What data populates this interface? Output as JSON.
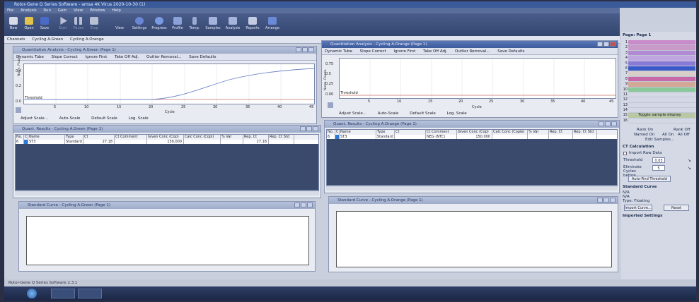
{
  "title": "Rotor-Gene Q Series Software - amsa 4K Virus 2020-10-30 (1)",
  "menu": [
    "File",
    "Analysis",
    "Run",
    "Gain",
    "View",
    "Window",
    "Help"
  ],
  "toolbar": {
    "new": "New",
    "open": "Open",
    "save": "Save",
    "start": "Start",
    "pause": "Pause",
    "stop": "Stop",
    "view": "View",
    "settings": "Settings",
    "progress": "Progress",
    "profile": "Profile",
    "temp": "Temp.",
    "samples": "Samples",
    "analysis": "Analysis",
    "reports": "Reports",
    "arrange": "Arrange"
  },
  "channels": {
    "label": "Channels",
    "green": "Cycling A.Green",
    "orange": "Cycling A.Orange"
  },
  "qa_green": {
    "title": "Quantitation Analysis - Cycling A.Green (Page 1)",
    "tools": [
      "Dynamic Tube",
      "Slope Correct",
      "Ignore First",
      "Take Off Adj.",
      "Outlier Removal...",
      "Save Defaults"
    ],
    "ylabel": "Norm. Fluoro.",
    "yticks": [
      "0.4",
      "0.2",
      "0.0"
    ],
    "xticks": [
      "5",
      "10",
      "15",
      "20",
      "25",
      "30",
      "35",
      "40",
      "45"
    ],
    "xlabel": "Cycle",
    "threshold": "Threshold",
    "scale": [
      "Adjust Scale...",
      "Auto-Scale",
      "Default Scale",
      "Log. Scale"
    ]
  },
  "qa_orange": {
    "title": "Quantitation Analysis - Cycling A.Orange (Page 1)",
    "tools": [
      "Dynamic Tube",
      "Slope Correct",
      "Ignore First",
      "Take Off Adj.",
      "Outlier Removal...",
      "Save Defaults"
    ],
    "ylabel": "Norm. Fluoro.",
    "yticks": [
      "0.75",
      "0.5",
      "0.25",
      "0.00"
    ],
    "xticks": [
      "5",
      "10",
      "15",
      "20",
      "25",
      "30",
      "35",
      "40",
      "45"
    ],
    "xlabel": "Cycle",
    "threshold": "Threshold",
    "scale": [
      "Adjust Scale...",
      "Auto-Scale",
      "Default Scale",
      "Log. Scale"
    ]
  },
  "qr_green": {
    "title": "Quant. Results - Cycling A.Green (Page 1)",
    "headers": [
      "No.",
      "C",
      "Name",
      "Type",
      "Ct",
      "Ct Comment",
      "Given Conc (Cop)",
      "Calc Conc (Copi)",
      "% Var",
      "Rep. Ct",
      "Rep. Ct Std"
    ],
    "row": [
      "6",
      "",
      "ST3",
      "Standard",
      "27.18",
      "",
      "150,000",
      "",
      "",
      "27.18",
      ""
    ]
  },
  "qr_orange": {
    "title": "Quant. Results - Cycling A.Orange (Page 1)",
    "headers": [
      "No.",
      "C",
      "Name",
      "Type",
      "Ct",
      "Ct Comment",
      "Given Conc (Cop)",
      "Calc Conc (Copie)",
      "% Var",
      "Rep. Ct",
      "Rep. Ct Std"
    ],
    "row": [
      "6",
      "",
      "ST3",
      "Standard",
      "",
      "NEG (NTC)",
      "150,000",
      "",
      "",
      "",
      ""
    ]
  },
  "sc_green": {
    "title": "Standard Curve - Cycling A.Green (Page 1)"
  },
  "sc_orange": {
    "title": "Standard Curve - Cycling A.Orange (Page 1)"
  },
  "right": {
    "page": "Page: Page 1",
    "row_numbers": [
      "1",
      "2",
      "3",
      "4",
      "5",
      "6",
      "7",
      "8",
      "9",
      "10",
      "11",
      "12",
      "13",
      "14",
      "15",
      "16"
    ],
    "toggle": "Toggle sample display",
    "rank_on": "Rank On",
    "rank_off": "Rank Off",
    "named_on": "Named On",
    "all_on": "All On",
    "all_off": "All Off",
    "edit": "Edit Samples...",
    "ct_calc": "CT Calculation",
    "import_raw": "Import Raw Data",
    "threshold_label": "Threshold",
    "threshold_value": "0.03",
    "elim_label": "Eliminate Cycles before",
    "elim_value": "5",
    "auto_find": "Auto-Find Threshold",
    "std_curve": "Standard Curve",
    "na1": "N/A",
    "na2": "N/A",
    "type": "Type: Floating",
    "import_curve": "Import Curve...",
    "reset": "Reset",
    "imported": "Imported Settings"
  },
  "statusbar": "Rotor-Gene Q Series Software 2.3.1",
  "colors": {
    "curve": "#6f86c8",
    "threshold": "#a0281e",
    "window_bg": "#e8ebf2",
    "table_empty": "#3a4a6c"
  }
}
